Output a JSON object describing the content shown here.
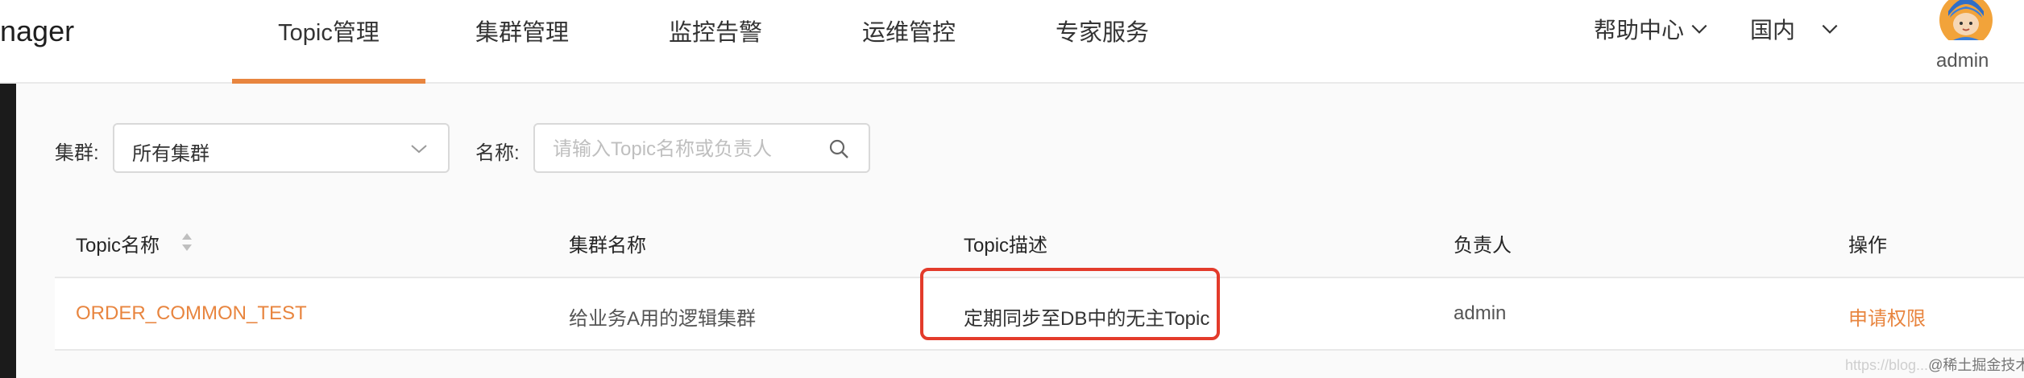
{
  "header": {
    "logo_text": "nager",
    "nav": [
      {
        "label": "Topic管理",
        "active": true
      },
      {
        "label": "集群管理"
      },
      {
        "label": "监控告警"
      },
      {
        "label": "运维管控"
      },
      {
        "label": "专家服务"
      }
    ],
    "help_label": "帮助中心",
    "region_label": "国内",
    "user_name": "admin"
  },
  "filters": {
    "cluster_label": "集群:",
    "cluster_value": "所有集群",
    "name_label": "名称:",
    "search_placeholder": "请输入Topic名称或负责人",
    "search_value": ""
  },
  "table": {
    "columns": [
      "Topic名称",
      "集群名称",
      "Topic描述",
      "负责人",
      "操作"
    ],
    "rows": [
      {
        "topic_name": "ORDER_COMMON_TEST",
        "cluster_name": "给业务A用的逻辑集群",
        "description": "定期同步至DB中的无主Topic",
        "owner": "admin",
        "action": "申请权限"
      }
    ]
  },
  "watermark": {
    "faint": "https://blog...",
    "text": "@稀土掘金技术社区"
  },
  "colors": {
    "accent": "#e8853f",
    "highlight": "#e33b2b",
    "dark_strip": "#1b1b1b"
  }
}
